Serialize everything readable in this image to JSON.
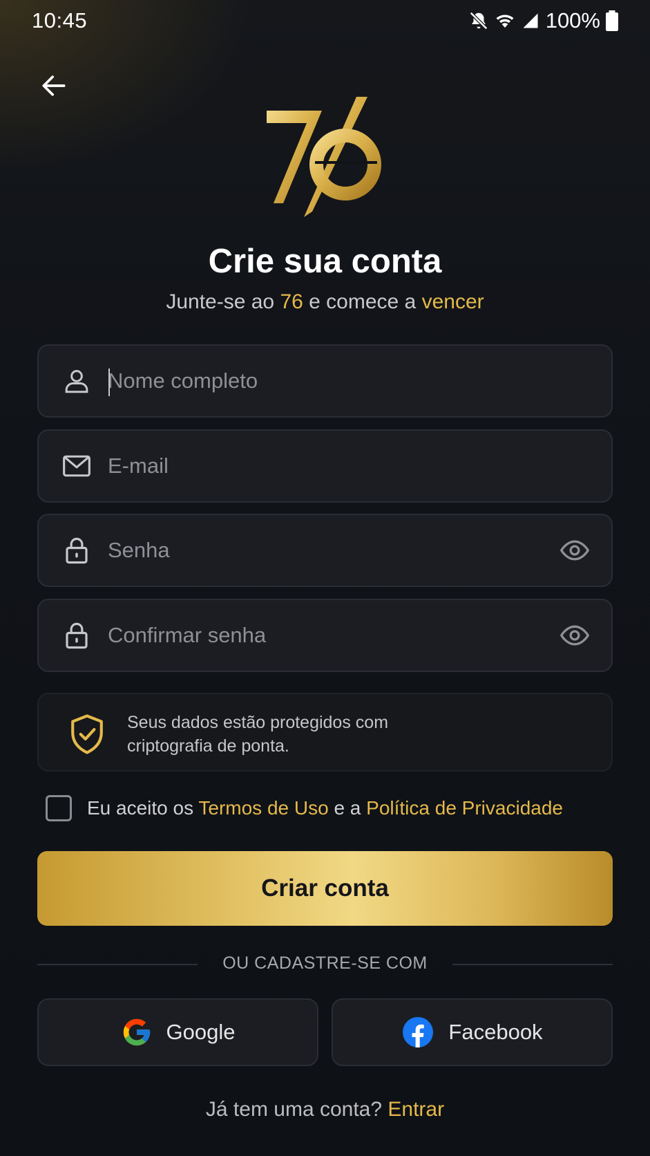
{
  "status_bar": {
    "time": "10:45",
    "battery": "100%"
  },
  "header": {
    "title": "Crie sua conta",
    "subtitle_part1": "Junte-se ao ",
    "subtitle_brand": "76",
    "subtitle_part2": " e comece a ",
    "subtitle_accent": "vencer"
  },
  "form": {
    "name_placeholder": "Nome completo",
    "email_placeholder": "E-mail",
    "password_placeholder": "Senha",
    "confirm_placeholder": "Confirmar senha"
  },
  "security_notice": {
    "line1": "Seus dados estão protegidos com",
    "line2": "criptografia de ponta."
  },
  "terms": {
    "prefix": "Eu aceito os ",
    "terms_link": "Termos de Uso",
    "middle": " e a ",
    "privacy_link": "Política de Privacidade",
    "checked": false
  },
  "primary_button": "Criar conta",
  "divider": "OU CADASTRE-SE COM",
  "social": {
    "google": "Google",
    "facebook": "Facebook"
  },
  "footer": {
    "question": "Já tem uma conta? ",
    "login_link": "Entrar"
  },
  "colors": {
    "gold": "#e5b94a",
    "background": "#101318",
    "field": "#1b1d22"
  },
  "icons": [
    "arrow-left-icon",
    "user-icon",
    "mail-icon",
    "lock-icon",
    "eye-icon",
    "shield-check-icon",
    "google-icon",
    "facebook-icon"
  ]
}
